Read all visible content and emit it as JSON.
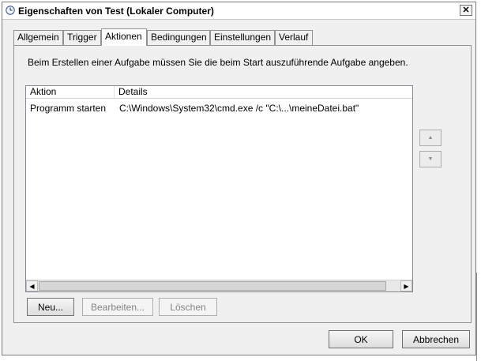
{
  "window": {
    "title": "Eigenschaften von Test (Lokaler Computer)",
    "close_symbol": "✕"
  },
  "tabs": [
    {
      "label": "Allgemein",
      "active": false
    },
    {
      "label": "Trigger",
      "active": false
    },
    {
      "label": "Aktionen",
      "active": true
    },
    {
      "label": "Bedingungen",
      "active": false
    },
    {
      "label": "Einstellungen",
      "active": false
    },
    {
      "label": "Verlauf",
      "active": false
    }
  ],
  "panel": {
    "instructions": "Beim Erstellen einer Aufgabe müssen Sie die beim Start auszuführende Aufgabe angeben."
  },
  "list": {
    "columns": [
      "Aktion",
      "Details"
    ],
    "rows": [
      {
        "action": "Programm starten",
        "details": "C:\\Windows\\System32\\cmd.exe /c \"C:\\...\\meineDatei.bat\""
      }
    ]
  },
  "move_buttons": {
    "up_icon": "up-arrow-icon",
    "down_icon": "down-arrow-icon"
  },
  "buttons": {
    "new": "Neu...",
    "edit": "Bearbeiten...",
    "delete": "Löschen",
    "ok": "OK",
    "cancel": "Abbrechen"
  }
}
